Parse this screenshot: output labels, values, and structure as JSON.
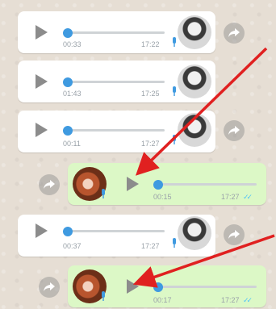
{
  "messages": [
    {
      "direction": "incoming",
      "duration": "00:33",
      "time": "17:22",
      "progress": 0
    },
    {
      "direction": "incoming",
      "duration": "01:43",
      "time": "17:25",
      "progress": 0
    },
    {
      "direction": "incoming",
      "duration": "00:11",
      "time": "17:27",
      "progress": 0
    },
    {
      "direction": "outgoing",
      "duration": "00:15",
      "time": "17:27",
      "progress": 0,
      "ticks": "✓✓"
    },
    {
      "direction": "incoming",
      "duration": "00:37",
      "time": "17:27",
      "progress": 0
    },
    {
      "direction": "outgoing",
      "duration": "00:17",
      "time": "17:27",
      "progress": 0,
      "ticks": "✓✓"
    }
  ],
  "colors": {
    "incoming_bubble": "#ffffff",
    "outgoing_bubble": "#dcf8c6",
    "knob": "#3f9ae0",
    "read_ticks": "#4fc3f7",
    "arrow": "#e02020"
  },
  "icons": [
    "play-icon",
    "mic-icon",
    "forward-icon",
    "avatar",
    "read-ticks-icon"
  ]
}
